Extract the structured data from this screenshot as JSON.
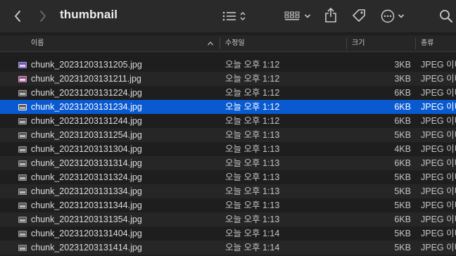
{
  "window": {
    "title": "thumbnail"
  },
  "toolbar": {
    "icons": [
      "chevron-left-icon",
      "chevron-right-icon",
      "list-view-icon",
      "sort-arrows-icon",
      "grid-view-icon",
      "chevron-down-icon",
      "share-icon",
      "tag-icon",
      "more-icon",
      "chevron-down-icon",
      "search-icon"
    ]
  },
  "columns": {
    "name": "이름",
    "date": "수정일",
    "size": "크기",
    "kind": "종류"
  },
  "files": [
    {
      "name": "chunk_20231203131205.jpg",
      "date": "오늘 오후 1:12",
      "size": "3KB",
      "kind": "JPEG 이미지",
      "thumb": "violet"
    },
    {
      "name": "chunk_20231203131211.jpg",
      "date": "오늘 오후 1:12",
      "size": "3KB",
      "kind": "JPEG 이미지",
      "thumb": "pink"
    },
    {
      "name": "chunk_20231203131224.jpg",
      "date": "오늘 오후 1:12",
      "size": "6KB",
      "kind": "JPEG 이미지",
      "thumb": "gray"
    },
    {
      "name": "chunk_20231203131234.jpg",
      "date": "오늘 오후 1:12",
      "size": "6KB",
      "kind": "JPEG 이미지",
      "thumb": "gray",
      "selected": true
    },
    {
      "name": "chunk_20231203131244.jpg",
      "date": "오늘 오후 1:12",
      "size": "6KB",
      "kind": "JPEG 이미지",
      "thumb": "gray"
    },
    {
      "name": "chunk_20231203131254.jpg",
      "date": "오늘 오후 1:13",
      "size": "5KB",
      "kind": "JPEG 이미지",
      "thumb": "gray"
    },
    {
      "name": "chunk_20231203131304.jpg",
      "date": "오늘 오후 1:13",
      "size": "4KB",
      "kind": "JPEG 이미지",
      "thumb": "gray"
    },
    {
      "name": "chunk_20231203131314.jpg",
      "date": "오늘 오후 1:13",
      "size": "6KB",
      "kind": "JPEG 이미지",
      "thumb": "gray"
    },
    {
      "name": "chunk_20231203131324.jpg",
      "date": "오늘 오후 1:13",
      "size": "5KB",
      "kind": "JPEG 이미지",
      "thumb": "gray"
    },
    {
      "name": "chunk_20231203131334.jpg",
      "date": "오늘 오후 1:13",
      "size": "5KB",
      "kind": "JPEG 이미지",
      "thumb": "gray"
    },
    {
      "name": "chunk_20231203131344.jpg",
      "date": "오늘 오후 1:13",
      "size": "5KB",
      "kind": "JPEG 이미지",
      "thumb": "gray"
    },
    {
      "name": "chunk_20231203131354.jpg",
      "date": "오늘 오후 1:13",
      "size": "6KB",
      "kind": "JPEG 이미지",
      "thumb": "gray"
    },
    {
      "name": "chunk_20231203131404.jpg",
      "date": "오늘 오후 1:14",
      "size": "5KB",
      "kind": "JPEG 이미지",
      "thumb": "gray"
    },
    {
      "name": "chunk_20231203131414.jpg",
      "date": "오늘 오후 1:14",
      "size": "5KB",
      "kind": "JPEG 이미지",
      "thumb": "gray"
    }
  ],
  "colors": {
    "selection": "#0959d0",
    "background": "#1e1e1e",
    "toolbar": "#2a2a2a"
  }
}
